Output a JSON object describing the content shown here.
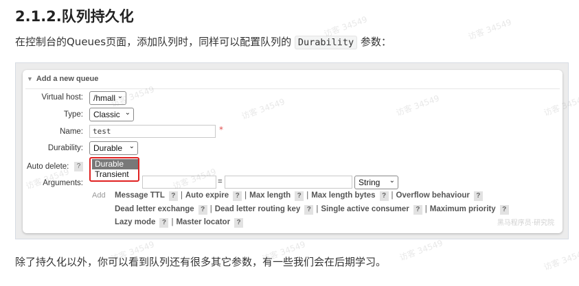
{
  "heading": "2.1.2.队列持久化",
  "intro": {
    "before": "在控制台的Queues页面，添加队列时，同样可以配置队列的 ",
    "code": "Durability",
    "after": " 参数："
  },
  "panel": {
    "title": "Add a new queue",
    "fields": {
      "virtual_host": {
        "label": "Virtual host:",
        "value": "/hmall"
      },
      "type": {
        "label": "Type:",
        "value": "Classic"
      },
      "name": {
        "label": "Name:",
        "value": "test",
        "required": "*"
      },
      "durability": {
        "label": "Durability:",
        "value": "Durable",
        "options": [
          "Durable",
          "Transient"
        ]
      },
      "auto_delete": {
        "label": "Auto delete:",
        "help": "?"
      },
      "arguments": {
        "label": "Arguments:",
        "equals": "=",
        "type_value": "String"
      }
    },
    "add_label": "Add",
    "argument_links": [
      [
        "Message TTL",
        "Auto expire",
        "Max length",
        "Max length bytes",
        "Overflow behaviour"
      ],
      [
        "Dead letter exchange",
        "Dead letter routing key",
        "Single active consumer",
        "Maximum priority"
      ],
      [
        "Lazy mode",
        "Master locator"
      ]
    ],
    "watermark_brand": "黑马程序员·研究院"
  },
  "watermark_text": "访客 34549",
  "closing": "除了持久化以外，你可以看到队列还有很多其它参数，有一些我们会在后期学习。"
}
